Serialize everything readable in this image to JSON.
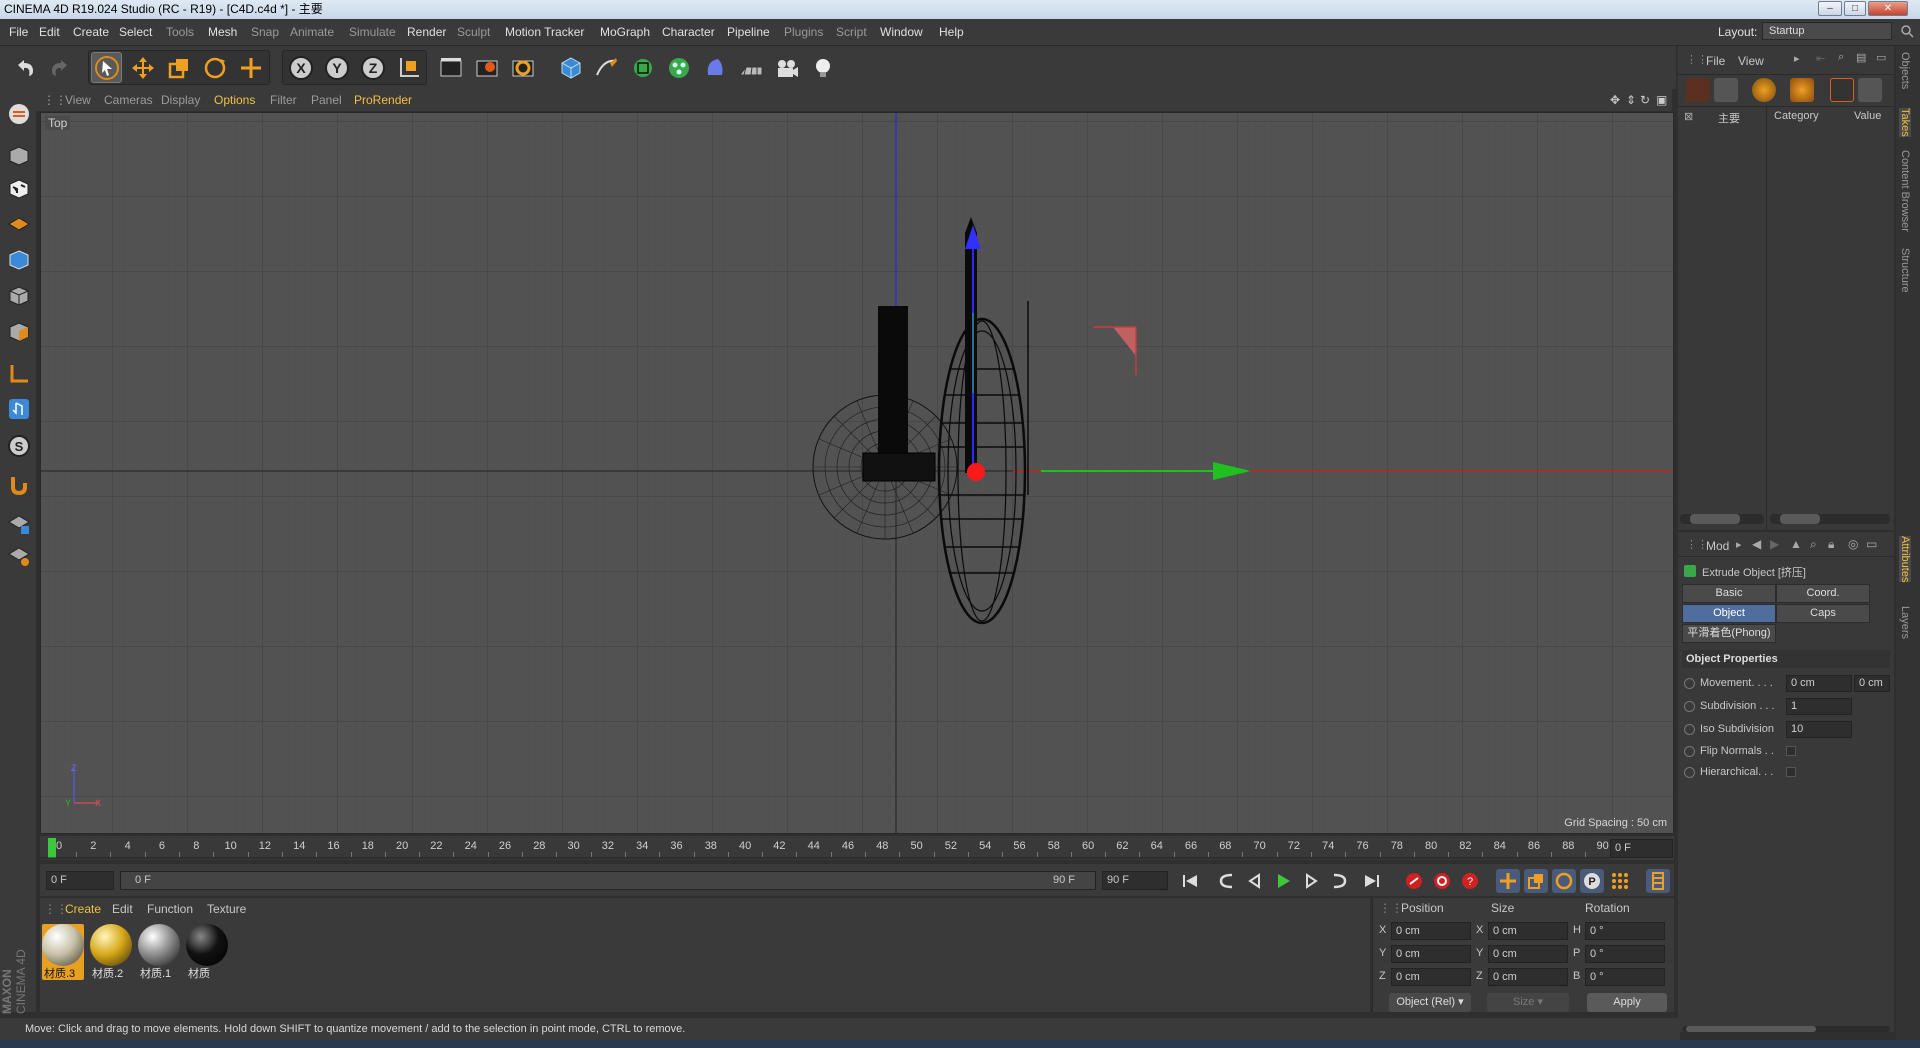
{
  "window": {
    "title": "CINEMA 4D R19.024 Studio (RC - R19) - [C4D.c4d *] - 主要",
    "layout_label": "Layout:",
    "layout_value": "Startup"
  },
  "menu": [
    "File",
    "Edit",
    "Create",
    "Select",
    "Tools",
    "Mesh",
    "Snap",
    "Animate",
    "Simulate",
    "Render",
    "Sculpt",
    "Motion Tracker",
    "MoGraph",
    "Character",
    "Pipeline",
    "Plugins",
    "Script",
    "Window",
    "Help"
  ],
  "viewport": {
    "menu": [
      "View",
      "Cameras",
      "Display",
      "Options",
      "Filter",
      "Panel",
      "ProRender"
    ],
    "label": "Top",
    "grid_spacing": "Grid Spacing : 50 cm",
    "axis_y": "Z",
    "axis_x": "X",
    "axis_o": "Y"
  },
  "timeline": {
    "ticks": [
      "0",
      "2",
      "4",
      "6",
      "8",
      "10",
      "12",
      "14",
      "16",
      "18",
      "20",
      "22",
      "24",
      "26",
      "28",
      "30",
      "32",
      "34",
      "36",
      "38",
      "40",
      "42",
      "44",
      "46",
      "48",
      "50",
      "52",
      "54",
      "56",
      "58",
      "60",
      "62",
      "64",
      "66",
      "68",
      "70",
      "72",
      "74",
      "76",
      "78",
      "80",
      "82",
      "84",
      "86",
      "88",
      "90"
    ],
    "current_frame": "0 F",
    "start": "0 F",
    "range_start": "0 F",
    "range_end": "90 F",
    "end": "90 F"
  },
  "materials": {
    "tabs": [
      "Create",
      "Edit",
      "Function",
      "Texture"
    ],
    "items": [
      {
        "label": "材质.3",
        "color": "#c9c2a8"
      },
      {
        "label": "材质.2",
        "color": "#d7a91a"
      },
      {
        "label": "材质.1",
        "color": "#9a9a9a"
      },
      {
        "label": "材质",
        "color": "#111111"
      }
    ]
  },
  "coords": {
    "headers": [
      "Position",
      "Size",
      "Rotation"
    ],
    "rows": [
      {
        "a": "X",
        "pos": "0 cm",
        "b": "X",
        "size": "0 cm",
        "c": "H",
        "rot": "0 °"
      },
      {
        "a": "Y",
        "pos": "0 cm",
        "b": "Y",
        "size": "0 cm",
        "c": "P",
        "rot": "0 °"
      },
      {
        "a": "Z",
        "pos": "0 cm",
        "b": "Z",
        "size": "0 cm",
        "c": "B",
        "rot": "0 °"
      }
    ],
    "mode": "Object (Rel)",
    "size_mode": "Size",
    "apply": "Apply"
  },
  "status": "Move: Click and drag to move elements. Hold down SHIFT to quantize movement / add to the selection in point mode, CTRL to remove.",
  "objects": {
    "menu": [
      "File",
      "View"
    ],
    "name_col": "主要",
    "cols": [
      "Category",
      "Value"
    ]
  },
  "attributes": {
    "mode": "Mod",
    "title": "Extrude Object [挤压]",
    "tabs": [
      "Basic",
      "Coord.",
      "Object",
      "Caps"
    ],
    "phong": "平滑着色(Phong)",
    "section": "Object Properties",
    "props": [
      {
        "label": "Movement. . . .",
        "v1": "0 cm",
        "v2": "0 cm"
      },
      {
        "label": "Subdivision . . .",
        "v1": "1"
      },
      {
        "label": "Iso Subdivision",
        "v1": "10"
      },
      {
        "label": "Flip Normals . .",
        "check": true
      },
      {
        "label": "Hierarchical. . .",
        "check": true
      }
    ]
  },
  "right_tabs": [
    "Objects",
    "Takes",
    "Content Browser",
    "Structure",
    "Attributes",
    "Layers"
  ],
  "brand": {
    "line1": "MAXON",
    "line2": "CINEMA 4D"
  },
  "colors": {
    "accent": "#f0c040",
    "x_axis": "#20c020",
    "z_axis": "#3030ff",
    "origin": "#ff2020"
  }
}
